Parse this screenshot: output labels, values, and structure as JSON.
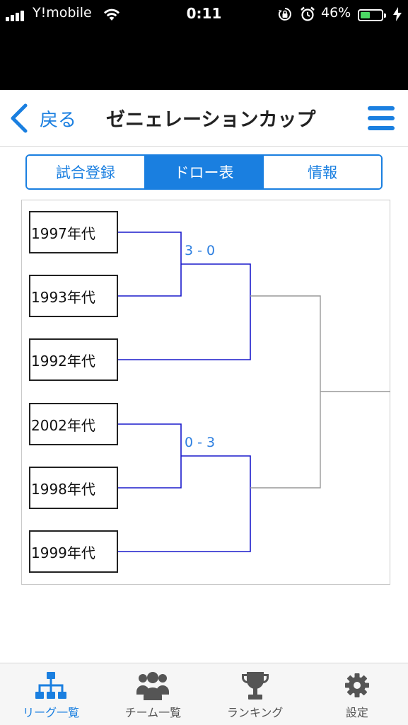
{
  "status_bar": {
    "carrier": "Y!mobile",
    "time": "0:11",
    "battery_percent_label": "46%",
    "battery_level": 0.46
  },
  "nav": {
    "back_label": "戻る",
    "title": "ゼニェレーションカップ"
  },
  "segments": [
    {
      "label": "試合登録",
      "active": false
    },
    {
      "label": "ドロー表",
      "active": true
    },
    {
      "label": "情報",
      "active": false
    }
  ],
  "bracket": {
    "teams": [
      "1997年代",
      "1993年代",
      "1992年代",
      "2002年代",
      "1998年代",
      "1999年代"
    ],
    "scores": [
      "3 - 0",
      "0 - 3"
    ]
  },
  "tabs": [
    {
      "label": "リーグ一覧",
      "icon": "tournament-tree-icon",
      "active": true
    },
    {
      "label": "チーム一覧",
      "icon": "team-users-icon",
      "active": false
    },
    {
      "label": "ランキング",
      "icon": "trophy-icon",
      "active": false
    },
    {
      "label": "設定",
      "icon": "gear-icon",
      "active": false
    }
  ],
  "colors": {
    "accent": "#1a7fe0",
    "bracket_played_line": "#1a1acc",
    "bracket_pending_line": "#999999",
    "score_text": "#2d7fe0"
  }
}
